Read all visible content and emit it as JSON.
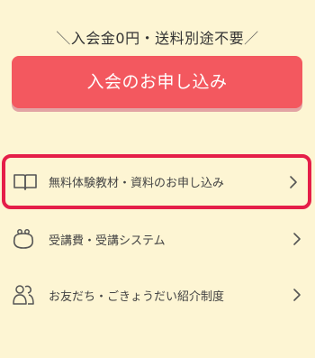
{
  "promo": {
    "text": "入会金0円・送料別途不要",
    "slash_left": "＼",
    "slash_right": "／"
  },
  "cta": {
    "label": "入会のお申し込み"
  },
  "menu": {
    "items": [
      {
        "label": "無料体験教材・資料のお申し込み",
        "icon": "book-icon"
      },
      {
        "label": "受講費・受講システム",
        "icon": "coin-purse-icon"
      },
      {
        "label": "お友だち・ごきょうだい紹介制度",
        "icon": "friends-icon"
      }
    ]
  },
  "colors": {
    "background": "#fdf5d3",
    "cta": "#f3585f",
    "highlight_border": "#e51e49"
  }
}
